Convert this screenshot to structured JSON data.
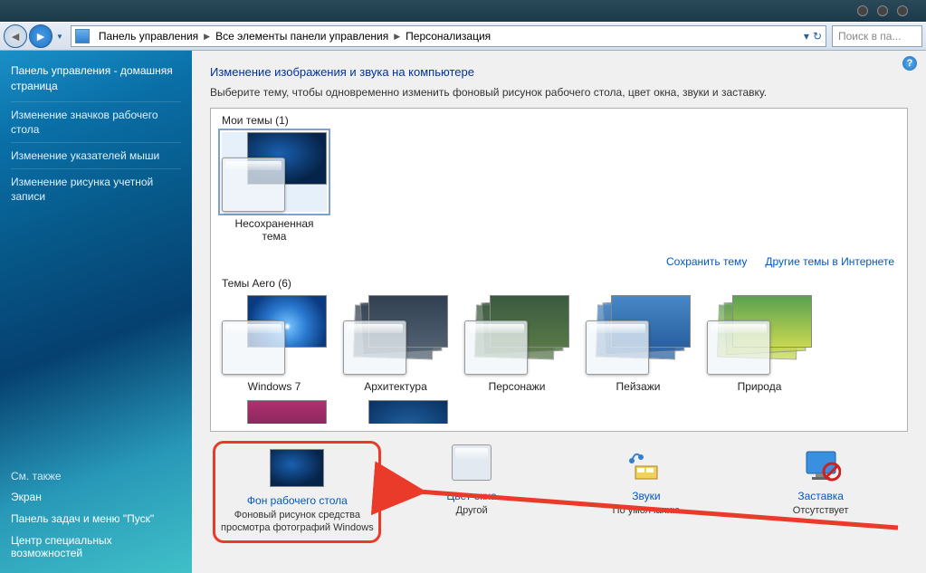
{
  "toolbar": {
    "breadcrumbs": [
      "Панель управления",
      "Все элементы панели управления",
      "Персонализация"
    ],
    "search_placeholder": "Поиск в па..."
  },
  "sidebar": {
    "home": "Панель управления - домашняя страница",
    "links": [
      "Изменение значков рабочего стола",
      "Изменение указателей мыши",
      "Изменение рисунка учетной записи"
    ],
    "see_also_header": "См. также",
    "footer_links": [
      "Экран",
      "Панель задач и меню \"Пуск\"",
      "Центр специальных возможностей"
    ]
  },
  "content": {
    "heading": "Изменение изображения и звука на компьютере",
    "description": "Выберите тему, чтобы одновременно изменить фоновый рисунок рабочего стола, цвет окна, звуки и заставку.",
    "my_themes_header": "Мои темы (1)",
    "my_themes": [
      {
        "label": "Несохраненная тема"
      }
    ],
    "save_theme": "Сохранить тему",
    "more_themes": "Другие темы в Интернете",
    "aero_header": "Темы Aero (6)",
    "aero_themes": [
      {
        "label": "Windows 7"
      },
      {
        "label": "Архитектура"
      },
      {
        "label": "Персонажи"
      },
      {
        "label": "Пейзажи"
      },
      {
        "label": "Природа"
      }
    ]
  },
  "bottom": {
    "wallpaper": {
      "title": "Фон рабочего стола",
      "sub": "Фоновый рисунок средства просмотра фотографий Windows"
    },
    "color": {
      "title": "Цвет окна",
      "sub": "Другой"
    },
    "sounds": {
      "title": "Звуки",
      "sub": "По умолчанию"
    },
    "screensaver": {
      "title": "Заставка",
      "sub": "Отсутствует"
    }
  }
}
